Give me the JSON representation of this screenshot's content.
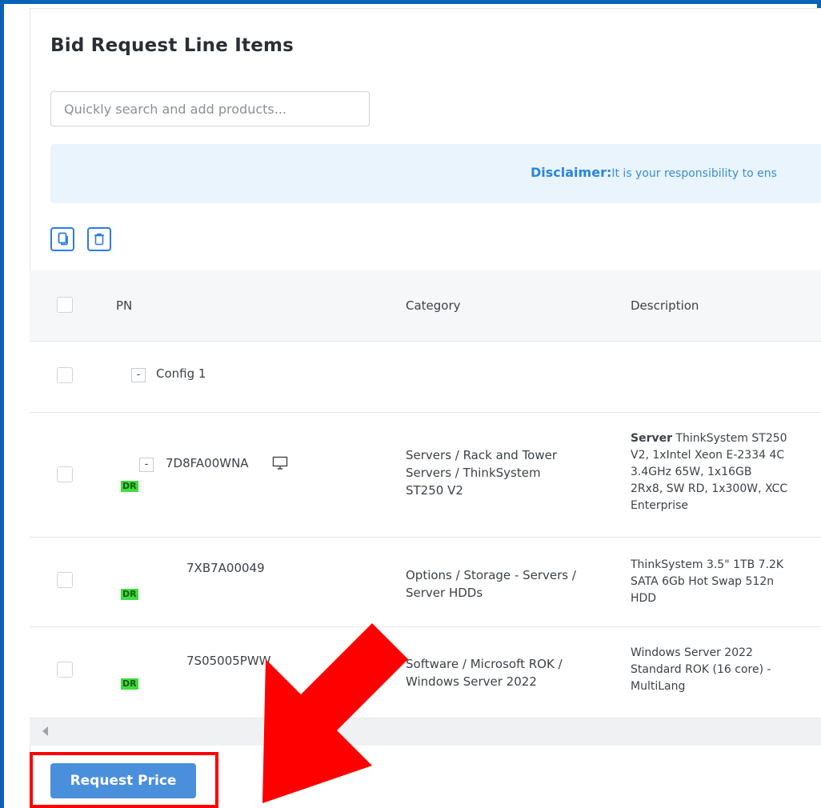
{
  "panel": {
    "title": "Bid Request Line Items"
  },
  "search": {
    "placeholder": "Quickly search and add products..."
  },
  "disclaimer": {
    "label": "Disclaimer:",
    "text": "It is your responsibility to ens"
  },
  "toolbar": {
    "copy_icon": "copy-icon",
    "delete_icon": "trash-icon"
  },
  "table": {
    "headers": {
      "pn": "PN",
      "category": "Category",
      "description": "Description"
    },
    "rows": [
      {
        "type": "group",
        "pn": "Config 1",
        "toggle": "-"
      },
      {
        "pn": "7D8FA00WNA",
        "toggle": "-",
        "badge": "DR",
        "pn_icon": "monitor-icon",
        "category": [
          "Servers / Rack and Tower",
          "Servers / ThinkSystem",
          "ST250 V2"
        ],
        "description_bold": "Server",
        "description": [
          " ThinkSystem ST250",
          "V2, 1xIntel Xeon E-2334 4C",
          "3.4GHz 65W, 1x16GB",
          "2Rx8, SW RD, 1x300W, XCC",
          "Enterprise"
        ]
      },
      {
        "pn": "7XB7A00049",
        "badge": "DR",
        "category": [
          "Options / Storage - Servers /",
          "Server HDDs"
        ],
        "description": [
          "ThinkSystem 3.5\" 1TB 7.2K",
          "SATA 6Gb Hot Swap 512n",
          "HDD"
        ]
      },
      {
        "pn": "7S05005PWW",
        "badge": "DR",
        "category": [
          "Software / Microsoft ROK /",
          "Windows Server 2022"
        ],
        "description": [
          "Windows Server 2022",
          "Standard ROK (16 core) -",
          "MultiLang"
        ]
      }
    ]
  },
  "actions": {
    "request_price": "Request Price"
  },
  "annotation": {
    "color": "#ff0000"
  },
  "colors": {
    "accent": "#0a62b8",
    "button": "#4a8fdc",
    "badge": "#3fdc3f"
  }
}
